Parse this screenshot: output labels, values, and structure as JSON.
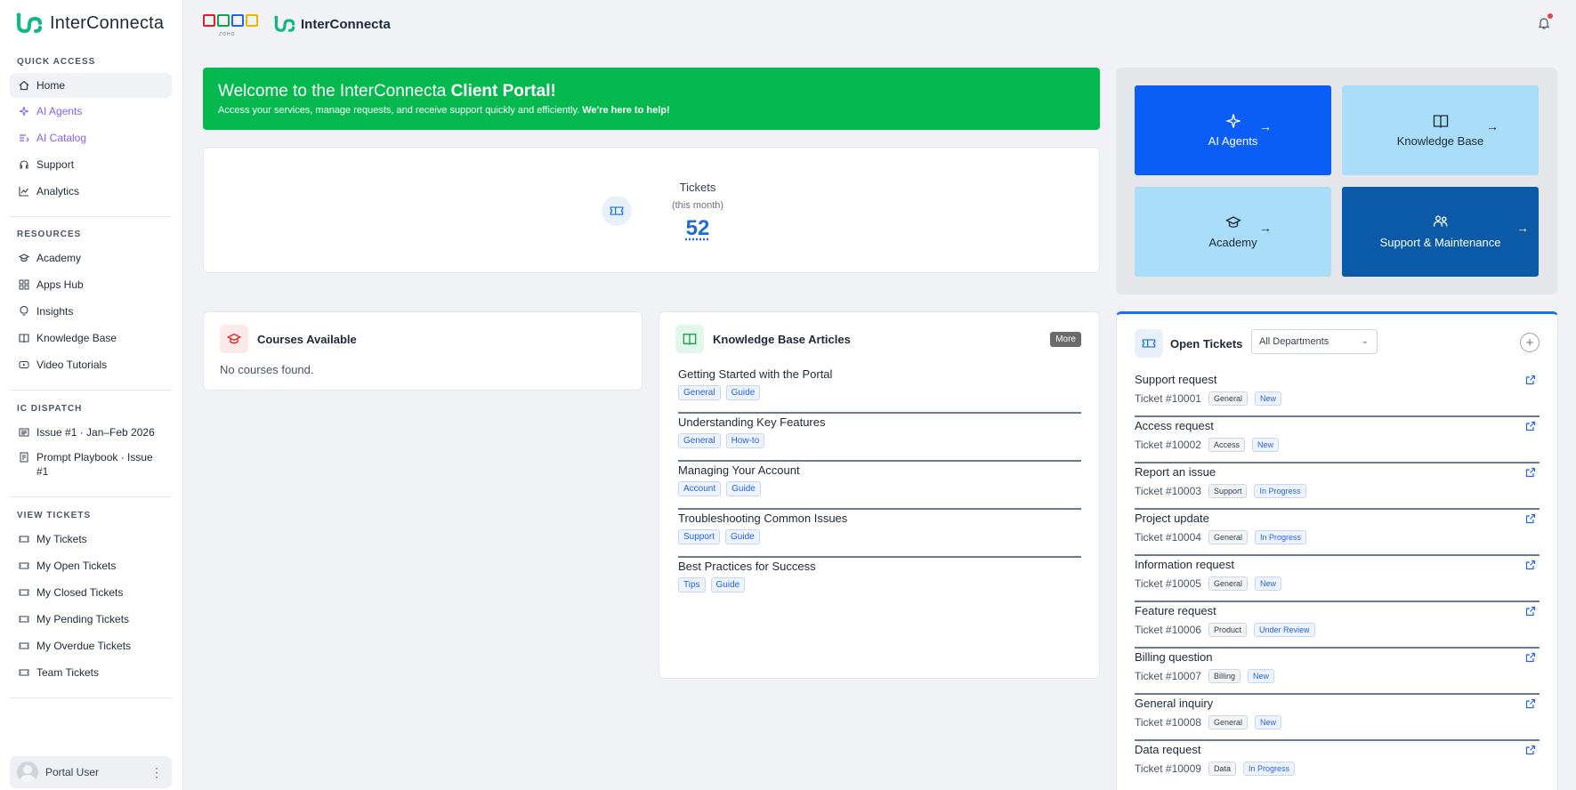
{
  "sidebar": {
    "brand": "InterConnecta",
    "quick_access_title": "QUICK ACCESS",
    "quick_access": [
      {
        "label": "Home",
        "icon": "home-icon"
      },
      {
        "label": "AI Agents",
        "icon": "sparkle-icon"
      },
      {
        "label": "AI Catalog",
        "icon": "list-icon"
      },
      {
        "label": "Support",
        "icon": "headset-icon"
      },
      {
        "label": "Analytics",
        "icon": "chart-icon"
      }
    ],
    "resources_title": "RESOURCES",
    "resources": [
      {
        "label": "Academy",
        "icon": "graduation-cap-icon"
      },
      {
        "label": "Apps Hub",
        "icon": "grid-icon"
      },
      {
        "label": "Insights",
        "icon": "lightbulb-icon"
      },
      {
        "label": "Knowledge Base",
        "icon": "book-icon"
      },
      {
        "label": "Video Tutorials",
        "icon": "video-icon"
      }
    ],
    "dispatch_title": "IC DISPATCH",
    "dispatch": [
      {
        "label": "Issue #1 · Jan–Feb 2026",
        "icon": "newspaper-icon"
      },
      {
        "label": "Prompt Playbook · Issue #1",
        "icon": "document-icon"
      }
    ],
    "view_tickets_title": "VIEW TICKETS",
    "view_tickets": [
      {
        "label": "My Tickets",
        "icon": "ticket-icon"
      },
      {
        "label": "My Open Tickets",
        "icon": "ticket-icon"
      },
      {
        "label": "My Closed Tickets",
        "icon": "ticket-icon"
      },
      {
        "label": "My Pending Tickets",
        "icon": "ticket-icon"
      },
      {
        "label": "My Overdue Tickets",
        "icon": "ticket-icon"
      },
      {
        "label": "Team Tickets",
        "icon": "ticket-icon"
      }
    ],
    "user": "Portal User"
  },
  "topbar": {
    "zoho_text": "ZOHO",
    "brand": "InterConnecta"
  },
  "welcome": {
    "title_prefix": "Welcome to the InterConnecta ",
    "title_bold": "Client Portal!",
    "subtitle": "Access your services, manage requests, and receive support quickly and efficiently. ",
    "subtitle_bold": "We're here to help!"
  },
  "tickets_stat": {
    "label": "Tickets",
    "sub": "(this month)",
    "value": "52"
  },
  "tiles": [
    {
      "label": "AI Agents",
      "icon": "sparkle-icon"
    },
    {
      "label": "Knowledge Base",
      "icon": "book-icon"
    },
    {
      "label": "Academy",
      "icon": "graduation-cap-icon"
    },
    {
      "label": "Support & Maintenance",
      "icon": "people-icon"
    }
  ],
  "courses": {
    "title": "Courses Available",
    "empty": "No courses found."
  },
  "kb": {
    "title": "Knowledge Base Articles",
    "more": "More",
    "articles": [
      {
        "title": "Getting Started with the Portal",
        "tags": [
          "General",
          "Guide"
        ]
      },
      {
        "title": "Understanding Key Features",
        "tags": [
          "General",
          "How-to"
        ]
      },
      {
        "title": "Managing Your Account",
        "tags": [
          "Account",
          "Guide"
        ]
      },
      {
        "title": "Troubleshooting Common Issues",
        "tags": [
          "Support",
          "Guide"
        ]
      },
      {
        "title": "Best Practices for Success",
        "tags": [
          "Tips",
          "Guide"
        ]
      }
    ]
  },
  "open_tickets": {
    "title": "Open Tickets",
    "department": "All Departments",
    "add": "+",
    "tickets": [
      {
        "title": "Support request",
        "id": "Ticket #10001",
        "dept": "General",
        "status": "New"
      },
      {
        "title": "Access request",
        "id": "Ticket #10002",
        "dept": "Access",
        "status": "New"
      },
      {
        "title": "Report an issue",
        "id": "Ticket #10003",
        "dept": "Support",
        "status": "In Progress"
      },
      {
        "title": "Project update",
        "id": "Ticket #10004",
        "dept": "General",
        "status": "In Progress"
      },
      {
        "title": "Information request",
        "id": "Ticket #10005",
        "dept": "General",
        "status": "New"
      },
      {
        "title": "Feature request",
        "id": "Ticket #10006",
        "dept": "Product",
        "status": "Under Review"
      },
      {
        "title": "Billing question",
        "id": "Ticket #10007",
        "dept": "Billing",
        "status": "New"
      },
      {
        "title": "General inquiry",
        "id": "Ticket #10008",
        "dept": "General",
        "status": "New"
      },
      {
        "title": "Data request",
        "id": "Ticket #10009",
        "dept": "Data",
        "status": "In Progress"
      }
    ]
  },
  "colors": {
    "brand_green": "#05b94f",
    "accent_blue": "#0a5ef5",
    "navy": "#0a5aa8",
    "light_blue": "#a9ddf8",
    "purple": "#8b5cf6"
  }
}
